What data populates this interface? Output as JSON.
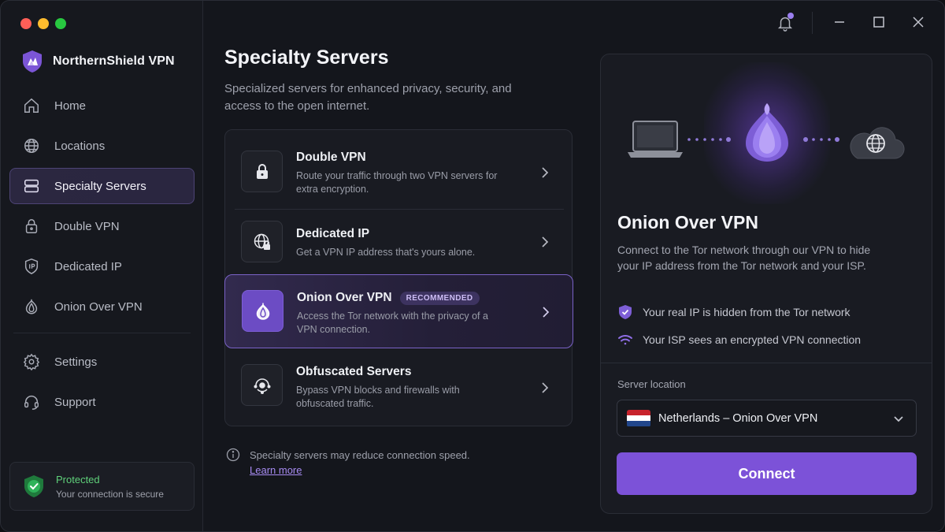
{
  "app": {
    "name": "NorthernShield VPN"
  },
  "colors": {
    "accent": "#7c52d8",
    "protected": "#5fd07a",
    "background": "#14161c"
  },
  "sidebar": {
    "items": [
      {
        "label": "Home",
        "icon": "home-icon"
      },
      {
        "label": "Locations",
        "icon": "globe-icon"
      },
      {
        "label": "Specialty Servers",
        "icon": "servers-icon",
        "active": true
      },
      {
        "label": "Double VPN",
        "icon": "lock-icon"
      },
      {
        "label": "Dedicated IP",
        "icon": "ip-shield-icon"
      },
      {
        "label": "Onion Over VPN",
        "icon": "onion-icon"
      }
    ],
    "secondary": [
      {
        "label": "Settings",
        "icon": "gear-icon"
      },
      {
        "label": "Support",
        "icon": "headset-icon"
      }
    ],
    "status": {
      "title": "Protected",
      "subtitle": "Your connection is secure"
    }
  },
  "main": {
    "title": "Specialty Servers",
    "subtitle": "Specialized servers for enhanced privacy, security, and access to the open internet.",
    "options": [
      {
        "name": "Double VPN",
        "desc": "Route your traffic through two VPN servers for extra encryption.",
        "icon": "lock-icon"
      },
      {
        "name": "Dedicated IP",
        "desc": "Get a VPN IP address that's yours alone.",
        "icon": "globe-lock-icon"
      },
      {
        "name": "Onion Over VPN",
        "badge": "RECOMMENDED",
        "desc": "Access the Tor network with the privacy of a VPN connection.",
        "icon": "onion-icon",
        "selected": true
      },
      {
        "name": "Obfuscated Servers",
        "desc": "Bypass VPN blocks and firewalls with obfuscated traffic.",
        "icon": "obfuscate-icon"
      }
    ],
    "note": "Specialty servers may reduce connection speed.",
    "note_link": "Learn more"
  },
  "panel": {
    "title": "Onion Over VPN",
    "description": "Connect to the Tor network through our VPN to hide your IP address from the Tor network and your ISP.",
    "features": [
      {
        "text": "Your real IP is hidden from the Tor network",
        "icon": "shield-check-icon"
      },
      {
        "text": "Your ISP sees an encrypted VPN connection",
        "icon": "wifi-icon"
      }
    ],
    "location_label": "Server location",
    "location_value": "Netherlands – Onion Over VPN",
    "connect_label": "Connect"
  }
}
